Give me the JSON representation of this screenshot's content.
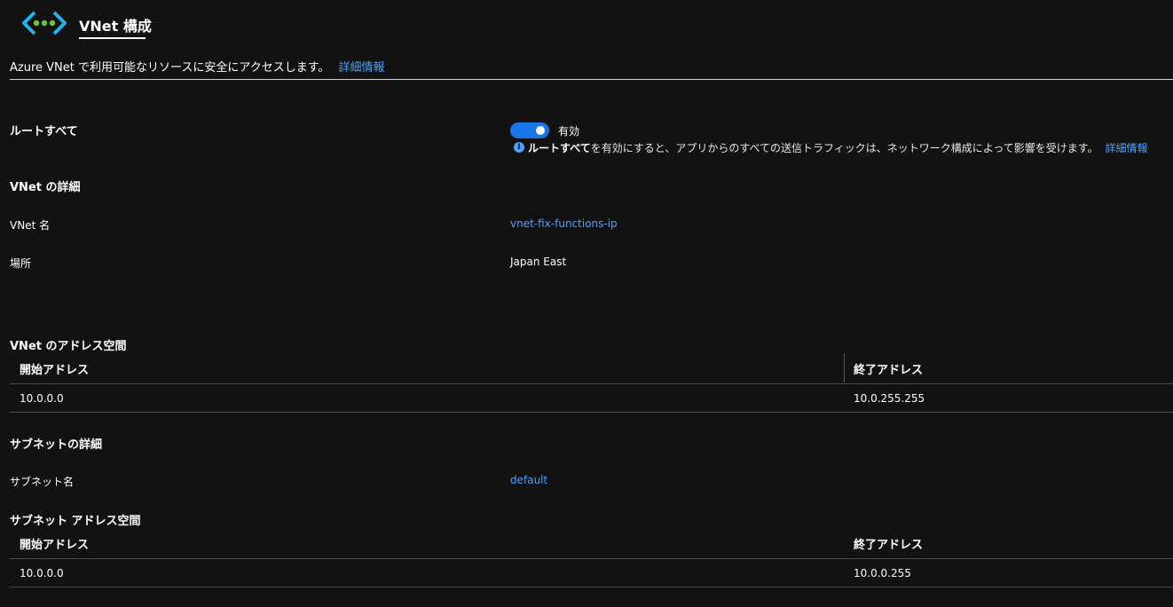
{
  "header": {
    "title": "VNet 構成"
  },
  "description": {
    "text": "Azure VNet で利用可能なリソースに安全にアクセスします。",
    "link": "詳細情報"
  },
  "route_all": {
    "label": "ルートすべて",
    "toggle_state": "有効",
    "info_bold": "ルートすべて",
    "info_text": "を有効にすると、アプリからのすべての送信トラフィックは、ネットワーク構成によって影響を受けます。",
    "info_link": "詳細情報"
  },
  "vnet_details": {
    "heading": "VNet の詳細",
    "name_label": "VNet 名",
    "name_value": "vnet-fix-functions-ip",
    "location_label": "場所",
    "location_value": "Japan East"
  },
  "vnet_address_space": {
    "heading": "VNet のアドレス空間",
    "columns": [
      "開始アドレス",
      "終了アドレス"
    ],
    "rows": [
      [
        "10.0.0.0",
        "10.0.255.255"
      ]
    ]
  },
  "subnet_details": {
    "heading": "サブネットの詳細",
    "name_label": "サブネット名",
    "name_value": "default"
  },
  "subnet_address_space": {
    "heading": "サブネット アドレス空間",
    "columns": [
      "開始アドレス",
      "終了アドレス"
    ],
    "rows": [
      [
        "10.0.0.0",
        "10.0.0.255"
      ]
    ]
  },
  "colors": {
    "background": "#121212",
    "link": "#4aa3ff",
    "toggle_on": "#1976e8"
  },
  "icons": {
    "header": "vnet-icon",
    "info": "info-icon"
  }
}
